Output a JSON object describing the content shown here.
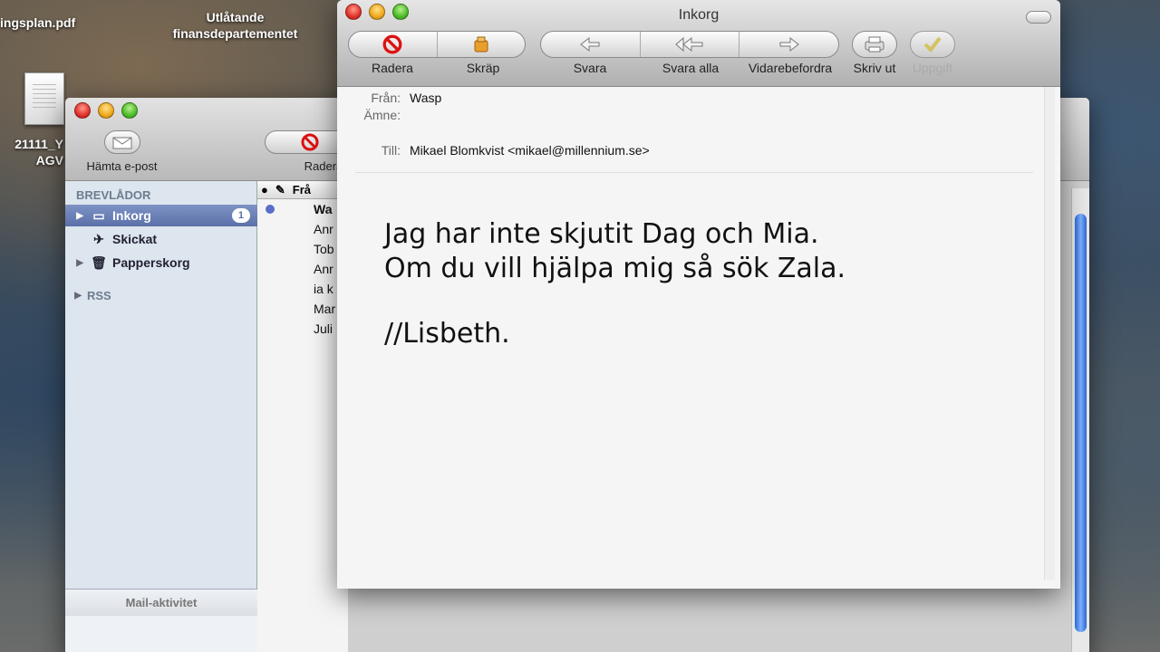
{
  "desktop": {
    "file1": "ingsplan.pdf",
    "file2_line1": "Utlåtande",
    "file2_line2": "finansdepartementet",
    "file3_line1": "21111_Y",
    "file3_line2": "AGV"
  },
  "back_window": {
    "toolbar": {
      "get_mail": "Hämta e-post",
      "delete": "Radera"
    },
    "sidebar": {
      "header": "BREVLÅDOR",
      "items": [
        {
          "label": "Inkorg",
          "badge": "1",
          "selected": true
        },
        {
          "label": "Skickat"
        },
        {
          "label": "Papperskorg"
        }
      ],
      "rss": "RSS",
      "activity": "Mail-aktivitet"
    },
    "list": {
      "col_from": "Frå",
      "rows": [
        "Wa",
        "Anr",
        "Tob",
        "Anr",
        "ia k",
        "Mar",
        "Juli"
      ]
    }
  },
  "front_window": {
    "title": "Inkorg",
    "toolbar": {
      "delete": "Radera",
      "junk": "Skräp",
      "reply": "Svara",
      "reply_all": "Svara alla",
      "forward": "Vidarebefordra",
      "print": "Skriv ut",
      "task": "Uppgift"
    },
    "headers": {
      "from_label": "Från:",
      "from_value": "Wasp",
      "subject_label": "Ämne:",
      "subject_value": "",
      "to_label": "Till:",
      "to_value": "Mikael Blomkvist <mikael@millennium.se>"
    },
    "body": {
      "line1": "Jag har inte skjutit Dag och Mia.",
      "line2": "Om du vill hjälpa mig så sök Zala.",
      "line3": "//Lisbeth."
    }
  },
  "colors": {
    "accent": "#5a70a8",
    "scroll": "#2a6ad0"
  }
}
